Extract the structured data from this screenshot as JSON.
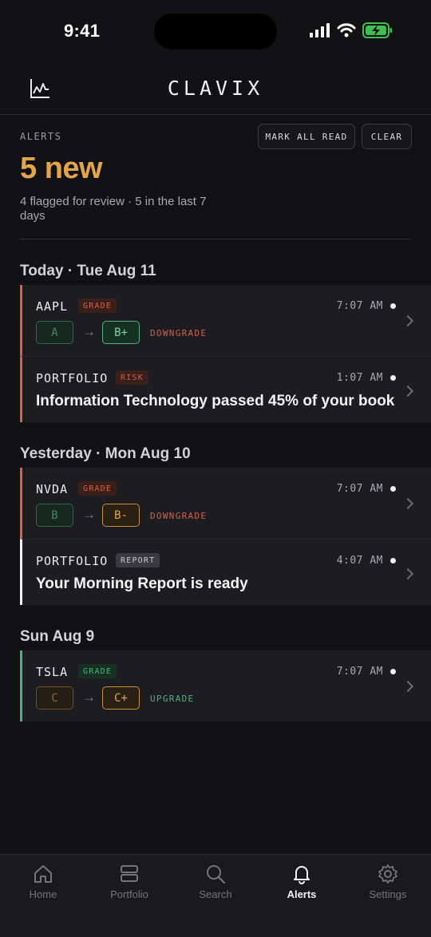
{
  "status_bar": {
    "time": "9:41"
  },
  "header": {
    "title": "CLAVIX",
    "chart_icon": "chart-line-icon"
  },
  "summary": {
    "label": "ALERTS",
    "mark_all_read": "MARK ALL READ",
    "clear": "CLEAR",
    "new_count": "5 new",
    "description": "4 flagged for review · 5 in the last 7 days"
  },
  "groups": [
    {
      "title": "Today · Tue Aug 11"
    },
    {
      "title": "Yesterday · Mon Aug 10"
    },
    {
      "title": "Sun Aug 9"
    }
  ],
  "alerts": [
    {
      "ticker": "AAPL",
      "badge": "GRADE",
      "time": "7:07 AM",
      "from": "A",
      "to": "B+",
      "arrow": "→",
      "change": "DOWNGRADE"
    },
    {
      "ticker": "PORTFOLIO",
      "badge": "RISK",
      "time": "1:07 AM",
      "message": "Information Technology passed 45% of your book"
    },
    {
      "ticker": "NVDA",
      "badge": "GRADE",
      "time": "7:07 AM",
      "from": "B",
      "to": "B-",
      "arrow": "→",
      "change": "DOWNGRADE"
    },
    {
      "ticker": "PORTFOLIO",
      "badge": "REPORT",
      "time": "4:07 AM",
      "message": "Your Morning Report is ready"
    },
    {
      "ticker": "TSLA",
      "badge": "GRADE",
      "time": "7:07 AM",
      "from": "C",
      "to": "C+",
      "arrow": "→",
      "change": "UPGRADE"
    }
  ],
  "colors": {
    "accent": "#e2a54a",
    "down": "#d4634a",
    "up": "#4fb27c",
    "background": "#121215"
  },
  "tabs": [
    {
      "label": "Home",
      "icon": "home-icon"
    },
    {
      "label": "Portfolio",
      "icon": "portfolio-icon"
    },
    {
      "label": "Search",
      "icon": "search-icon"
    },
    {
      "label": "Alerts",
      "icon": "bell-icon",
      "active": true
    },
    {
      "label": "Settings",
      "icon": "gear-icon"
    }
  ]
}
